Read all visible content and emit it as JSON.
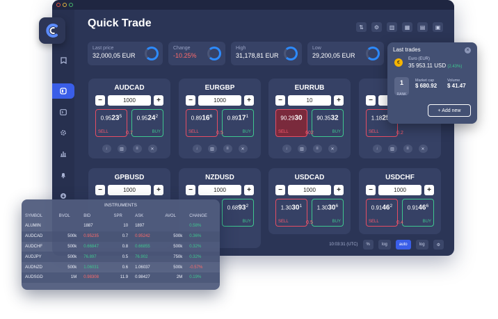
{
  "app": {
    "title": "Quick Trade"
  },
  "colors": {
    "accent": "#3a5ee8",
    "sell": "#e64d63",
    "buy": "#3ec78f",
    "background": "#2b3556"
  },
  "stats": [
    {
      "label": "Last price",
      "value": "32,000,05 EUR"
    },
    {
      "label": "Change",
      "value": "-10.25%"
    },
    {
      "label": "High",
      "value": "31,178,81 EUR"
    },
    {
      "label": "Low",
      "value": "29,200,05 EUR"
    }
  ],
  "cards": [
    {
      "pair": "AUDCAD",
      "amount": "1000",
      "sell_pre": "0.95",
      "sell_big": "23",
      "sell_sup": "5",
      "buy_pre": "0.95",
      "buy_big": "24",
      "buy_sup": "2",
      "spread": "0.7"
    },
    {
      "pair": "EURGBP",
      "amount": "1000",
      "sell_pre": "0.89",
      "sell_big": "16",
      "sell_sup": "6",
      "buy_pre": "0.89",
      "buy_big": "17",
      "buy_sup": "1",
      "spread": "0.5"
    },
    {
      "pair": "EURRUB",
      "amount": "10",
      "sell_pre": "90.29",
      "sell_big": "30",
      "sell_sup": "",
      "buy_pre": "90.35",
      "buy_big": "32",
      "buy_sup": "",
      "spread": "602"
    },
    {
      "pair": "",
      "amount": "",
      "sell_pre": "1.18",
      "sell_big": "25",
      "sell_sup": "1",
      "buy_pre": "",
      "buy_big": "",
      "buy_sup": "",
      "spread": "0.2"
    },
    {
      "pair": "GPBUSD",
      "amount": "1000",
      "sell_pre": "",
      "sell_big": "",
      "sell_sup": "",
      "buy_pre": "",
      "buy_big": "",
      "buy_sup": "",
      "spread": ""
    },
    {
      "pair": "NZDUSD",
      "amount": "1000",
      "sell_pre": "",
      "sell_big": "",
      "sell_sup": "",
      "buy_pre": "0.68",
      "buy_big": "93",
      "buy_sup": "2",
      "spread": ""
    },
    {
      "pair": "USDCAD",
      "amount": "1000",
      "sell_pre": "1.30",
      "sell_big": "30",
      "sell_sup": "1",
      "buy_pre": "1.30",
      "buy_big": "30",
      "buy_sup": "6",
      "spread": "0.5"
    },
    {
      "pair": "USDCHF",
      "amount": "1000",
      "sell_pre": "0.91",
      "sell_big": "46",
      "sell_sup": "2",
      "buy_pre": "0.91",
      "buy_big": "46",
      "buy_sup": "6",
      "spread": "0.4"
    }
  ],
  "labels": {
    "sell": "SELL",
    "buy": "BUY"
  },
  "last_trades": {
    "title": "Last trades",
    "coin_name": "Euro (EUR)",
    "coin_value": "35 953.11 USD",
    "coin_change": "(2.43%)",
    "rank": "1",
    "rank_label": "RANK",
    "market_cap_label": "Market cap",
    "market_cap": "$ 680.92",
    "volume_label": "Volume",
    "volume": "$ 41.47",
    "add_new": "+ Add new"
  },
  "status": {
    "time": "10:03:31 (UTC)",
    "b1": "%",
    "b2": "log",
    "b3": "auto",
    "b4": "log"
  },
  "instruments": {
    "title": "INSTRUMENTS",
    "columns": [
      "SYMBOL",
      "BVOL",
      "BID",
      "SPR",
      "ASK",
      "AVOL",
      "CHANGE"
    ],
    "rows": [
      {
        "symbol": "ALUMIN",
        "bvol": "",
        "bid": "1887",
        "spr": "10",
        "ask": "1897",
        "avol": "",
        "change": "0.58%"
      },
      {
        "symbol": "AUDCAD",
        "bvol": "500k",
        "bid": "0.95235",
        "spr": "0.7",
        "ask": "0.95242",
        "avol": "500k",
        "change": "0.36%"
      },
      {
        "symbol": "AUDCHF",
        "bvol": "500k",
        "bid": "0.66847",
        "spr": "0.8",
        "ask": "0.66855",
        "avol": "500k",
        "change": "0.32%"
      },
      {
        "symbol": "AUDJPY",
        "bvol": "500k",
        "bid": "76.897",
        "spr": "0.5",
        "ask": "76.902",
        "avol": "750k",
        "change": "0.32%"
      },
      {
        "symbol": "AUDNZD",
        "bvol": "500k",
        "bid": "1.06031",
        "spr": "0.6",
        "ask": "1.06037",
        "avol": "500k",
        "change": "-0.57%"
      },
      {
        "symbol": "AUDSGD",
        "bvol": "1M",
        "bid": "0.98308",
        "spr": "11.9",
        "ask": "0.98427",
        "avol": "2M",
        "change": "0.19%"
      }
    ]
  }
}
